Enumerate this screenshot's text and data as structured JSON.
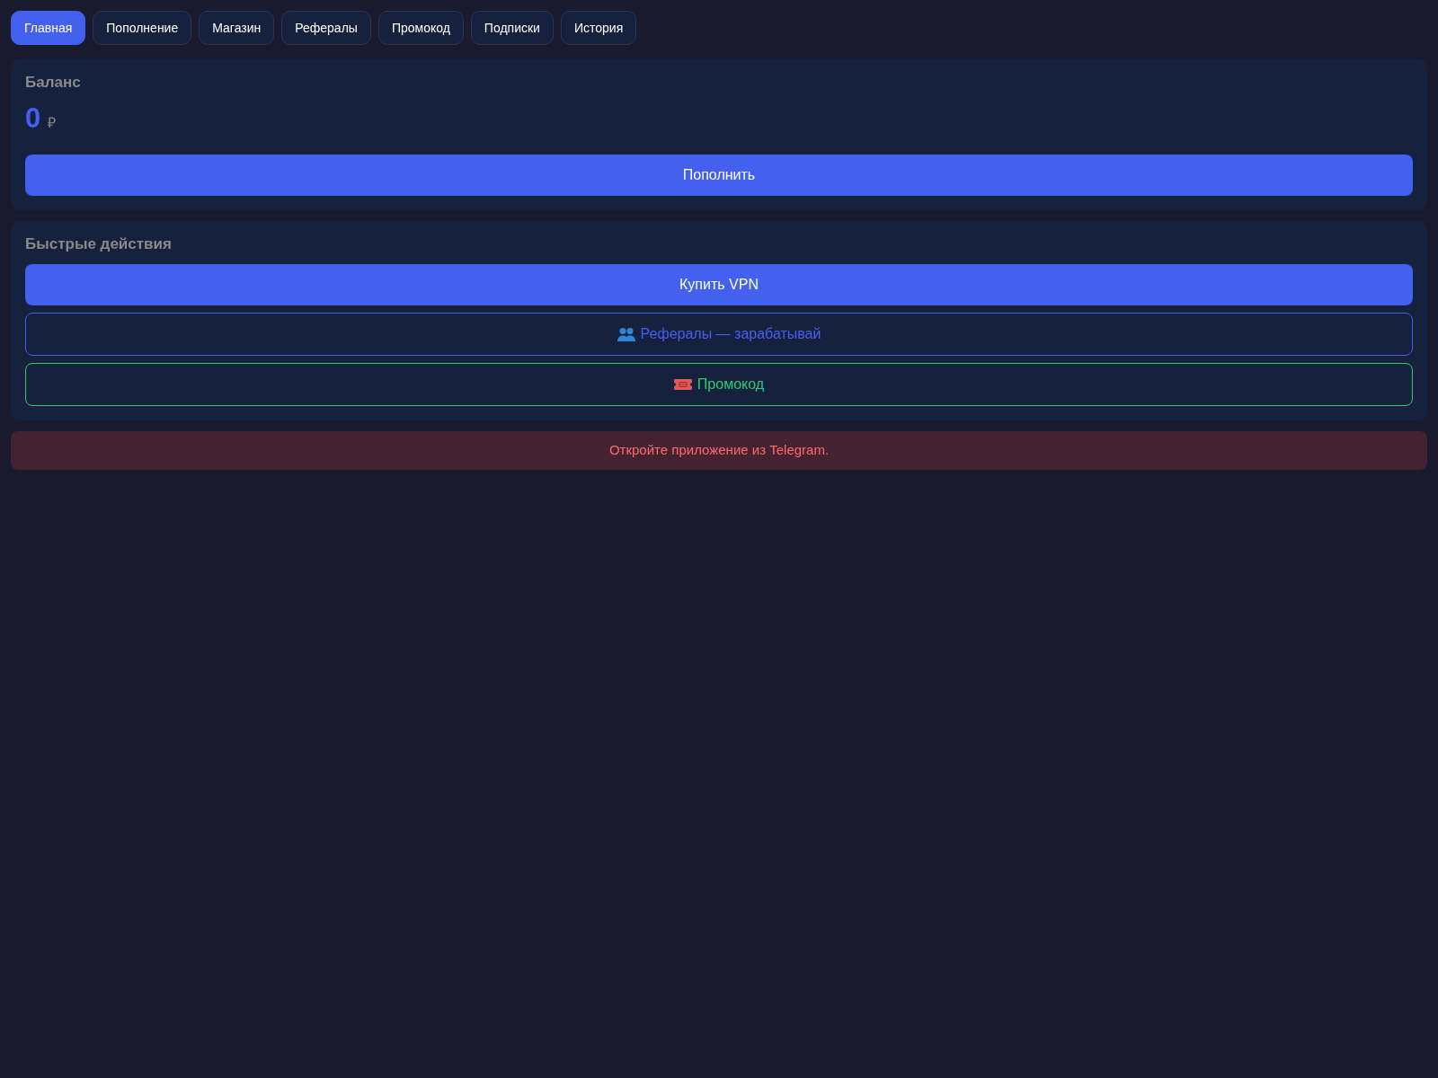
{
  "tabs": [
    {
      "label": "Главная",
      "selected": true
    },
    {
      "label": "Пополнение",
      "selected": false
    },
    {
      "label": "Магазин",
      "selected": false
    },
    {
      "label": "Рефералы",
      "selected": false
    },
    {
      "label": "Промокод",
      "selected": false
    },
    {
      "label": "Подписки",
      "selected": false
    },
    {
      "label": "История",
      "selected": false
    }
  ],
  "balance": {
    "title": "Баланс",
    "amount": "0",
    "currency": "₽",
    "button": "Пополнить"
  },
  "quick_actions": {
    "title": "Быстрые действия",
    "buttons": [
      {
        "label": "Купить VPN",
        "kind": "filled",
        "color": "#4361ee"
      },
      {
        "label": "Рефералы — зарабатывай",
        "kind": "outline",
        "color": "#4361ee"
      },
      {
        "label": "Промокод",
        "kind": "outline",
        "color": "#2ecc71"
      }
    ]
  },
  "alert": {
    "text": "Откройте приложение из Telegram."
  }
}
